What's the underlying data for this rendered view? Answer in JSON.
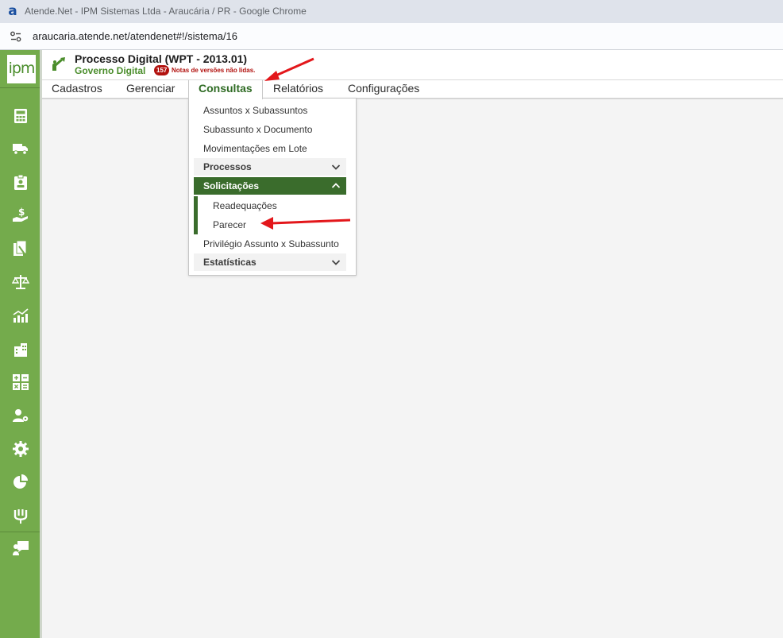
{
  "browser": {
    "favicon_letter": "a",
    "window_title": "Atende.Net - IPM Sistemas Ltda - Araucária / PR - Google Chrome",
    "url": "araucaria.atende.net/atendenet#!/sistema/16"
  },
  "sidebar": {
    "logo": "ipm",
    "icons": [
      "calculator-icon",
      "truck-icon",
      "id-badge-icon",
      "money-hand-icon",
      "documents-icon",
      "scales-icon",
      "chart-growth-icon",
      "building-icon",
      "math-operations-icon",
      "user-settings-icon",
      "gear-icon",
      "pie-chart-icon",
      "plug-icon",
      "presentation-icon"
    ]
  },
  "app": {
    "title": "Processo Digital (WPT - 2013.01)",
    "subtitle": "Governo Digital",
    "notes_count": "157",
    "notes_text": "Notas de versões não lidas."
  },
  "menu": {
    "cadastros": "Cadastros",
    "gerenciar": "Gerenciar",
    "consultas": "Consultas",
    "relatorios": "Relatórios",
    "configuracoes": "Configurações"
  },
  "dropdown": {
    "assuntos": "Assuntos x Subassuntos",
    "subassunto_documento": "Subassunto x Documento",
    "movimentacoes": "Movimentações em Lote",
    "processos": "Processos",
    "solicitacoes": "Solicitações",
    "readequacoes": "Readequações",
    "parecer": "Parecer",
    "privilegio": "Privilégio Assunto x Subassunto",
    "estatisticas": "Estatísticas"
  },
  "colors": {
    "sidebar_green": "#74ab4c",
    "brand_green": "#4a8d2b",
    "active_group": "#3a6c2c",
    "badge_red": "#b2120f",
    "annotation_arrow": "#e3171b"
  }
}
